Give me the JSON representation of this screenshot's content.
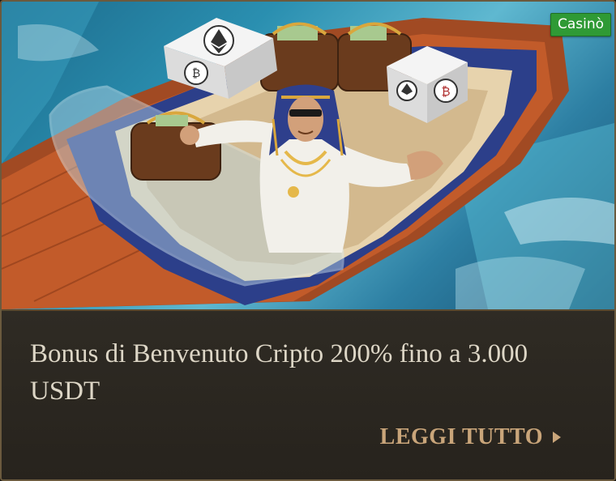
{
  "promo": {
    "badge": "Casinò",
    "title": "Bonus di Benvenuto Cripto 200% fino a 3.000 USDT",
    "cta_label": "LEGGI TUTTO"
  },
  "icons": {
    "cta": "play-arrow-icon",
    "dice_1": "ethereum-icon",
    "dice_1_side": "bitcoin-icon",
    "dice_2": "ethereum-icon",
    "dice_2_side": "bitcoin-icon"
  },
  "colors": {
    "badge_bg": "#2f9a35",
    "title_text": "#ddd6c6",
    "cta_text": "#c9a57a",
    "panel_bg": "#2a2620",
    "frame_border": "#6b5a3e"
  }
}
